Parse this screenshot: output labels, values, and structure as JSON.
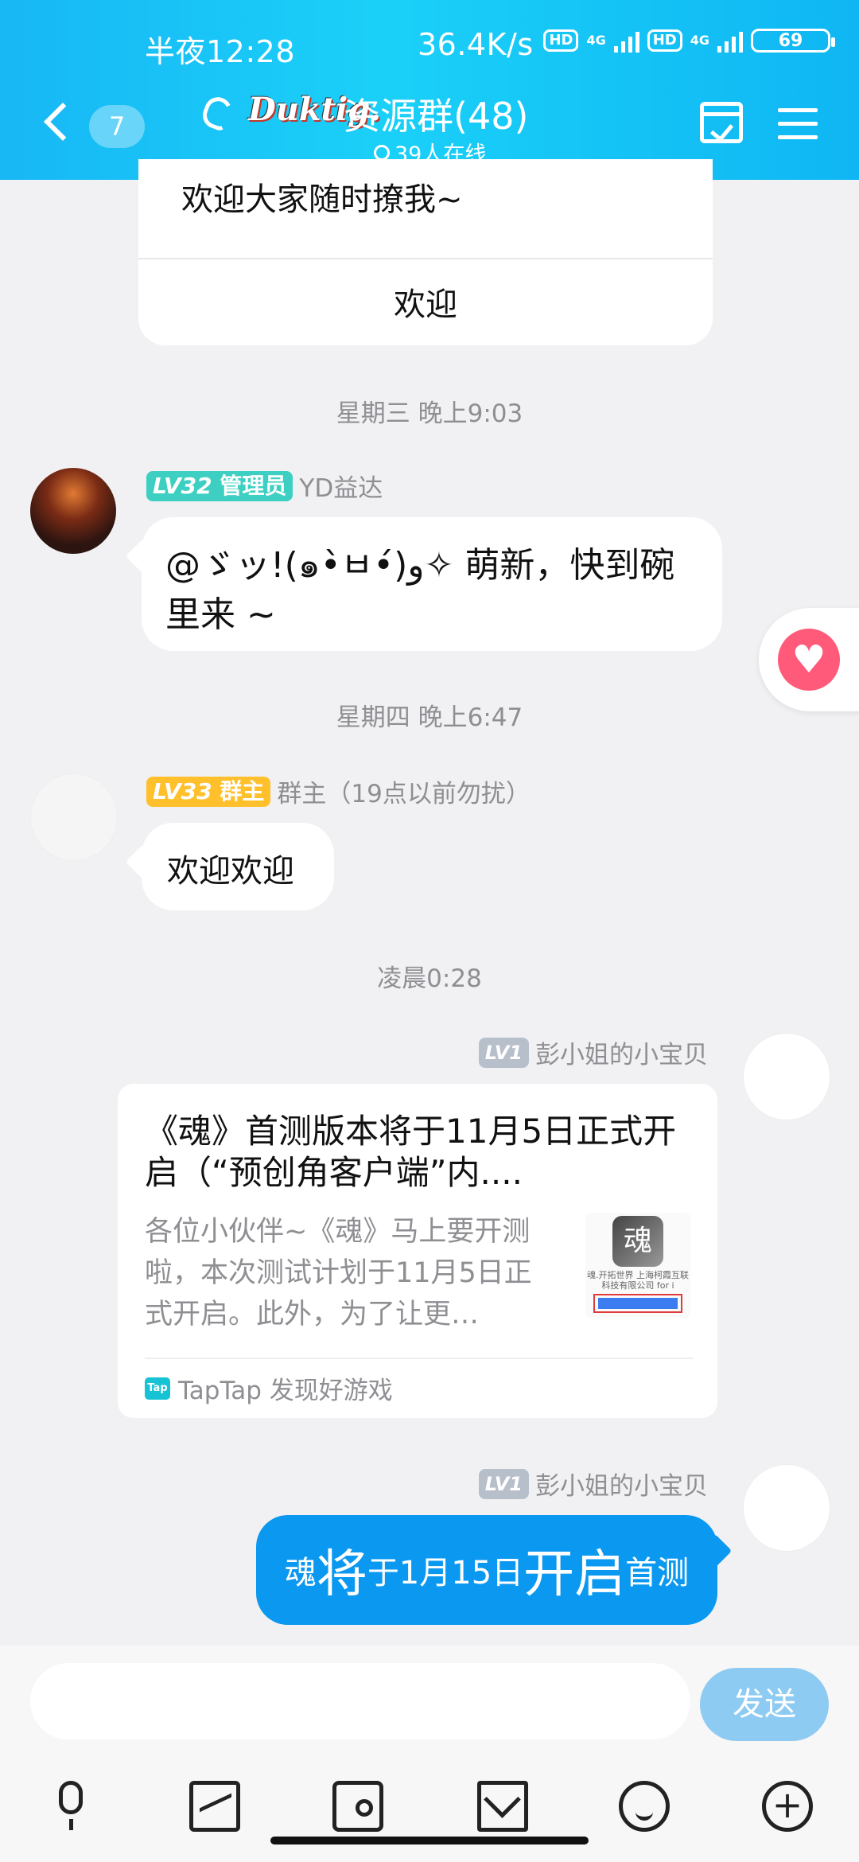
{
  "status_bar": {
    "time": "半夜12:28",
    "speed": "36.4K/s",
    "hd": "HD",
    "net": "4G",
    "battery": "69"
  },
  "header": {
    "back_count": "7",
    "logo": "Duktig.",
    "title": "资源群(48)",
    "online": "39人在线"
  },
  "system_card": {
    "text": "欢迎大家随时撩我~",
    "button": "欢迎"
  },
  "timestamps": [
    "星期三 晚上9:03",
    "星期四 晚上6:47",
    "凌晨0:28"
  ],
  "messages": [
    {
      "level": "LV32",
      "role": "管理员",
      "sender": "YD益达",
      "text": "@ゞッ!(๑•̀ㅂ•́)و✧ 萌新，快到碗里来 ~"
    },
    {
      "level": "LV33",
      "role": "群主",
      "sender": "群主（19点以前勿扰）",
      "text": "欢迎欢迎"
    },
    {
      "level": "LV1",
      "sender": "彭小姐的小宝贝",
      "card": {
        "title": "《魂》首测版本将于11月5日正式开启（“预创角客户端”内....",
        "desc": "各位小伙伴~《魂》马上要开测啦，本次测试计划于11月5日正式开启。此外，为了让更…",
        "thumb_icon": "魂",
        "thumb_text": "魂.开拓世界\n上海柯霞互联科技有限公司 for i",
        "source_icon": "Tap",
        "source": "TapTap 发现好游戏"
      }
    },
    {
      "level": "LV1",
      "sender": "彭小姐的小宝贝",
      "parts": [
        "魂",
        "将",
        "于1月15日",
        "开启",
        "首测"
      ]
    }
  ],
  "input": {
    "send": "发送"
  },
  "toolbar": [
    "mic-icon",
    "image-icon",
    "camera-icon",
    "red-packet-icon",
    "emoji-icon",
    "plus-icon"
  ],
  "colors": {
    "header": "#18b7f5",
    "admin": "#3ecfc3",
    "owner": "#ffc02c",
    "self_bubble": "#0b98f0",
    "heart": "#ff5a7a"
  }
}
